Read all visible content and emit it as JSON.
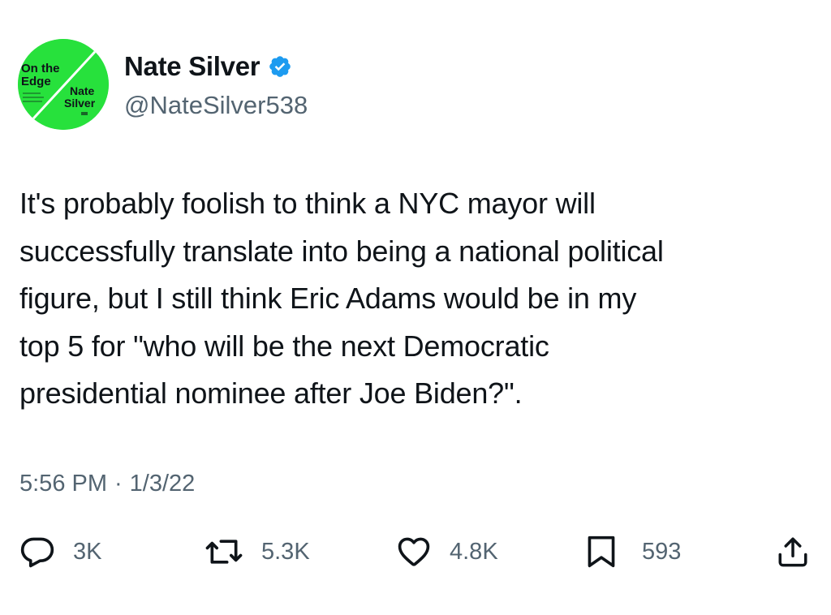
{
  "author": {
    "display_name": "Nate Silver",
    "handle": "@NateSilver538",
    "verified": true,
    "avatar": {
      "description_icon": "book-cover-avatar",
      "text_top_line1": "On the",
      "text_top_line2": "Edge",
      "text_name_line1": "Nate",
      "text_name_line2": "Silver",
      "background_color": "#27e13c"
    }
  },
  "tweet": {
    "text_lines": [
      "It's probably foolish to think a NYC mayor will",
      "successfully translate into being a national political",
      "figure, but I still think Eric Adams would be in my",
      "top 5 for \"who will be the next Democratic",
      "presidential nominee after Joe Biden?\"."
    ],
    "time": "5:56 PM",
    "separator": "·",
    "date": "1/3/22"
  },
  "actions": {
    "reply": {
      "icon": "reply-icon",
      "count": "3K"
    },
    "retweet": {
      "icon": "retweet-icon",
      "count": "5.3K"
    },
    "like": {
      "icon": "heart-icon",
      "count": "4.8K"
    },
    "bookmark": {
      "icon": "bookmark-icon",
      "count": "593"
    },
    "share": {
      "icon": "share-icon"
    }
  },
  "colors": {
    "text_primary": "#0f1419",
    "text_secondary": "#536471",
    "verified_badge": "#1d9bf0",
    "avatar_green": "#27e13c"
  }
}
